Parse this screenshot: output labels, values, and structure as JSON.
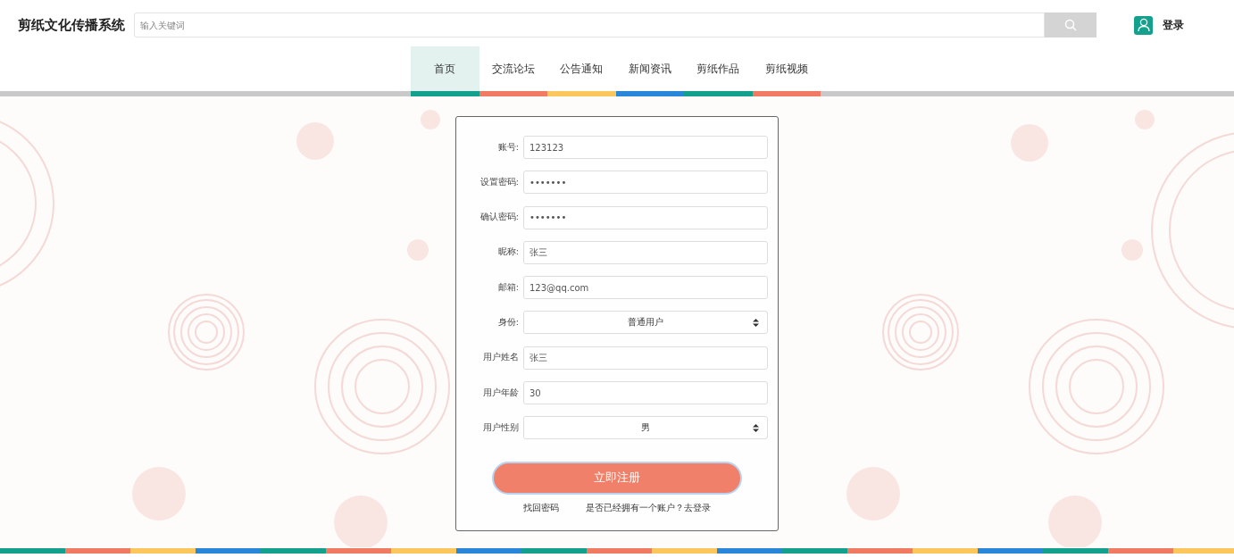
{
  "header": {
    "site_title": "剪纸文化传播系统",
    "search": {
      "placeholder": "输入关键词"
    },
    "login": "登录"
  },
  "nav": [
    {
      "label": "首页",
      "selected": true,
      "color": "#13a08c"
    },
    {
      "label": "交流论坛",
      "selected": false,
      "color": "#f07b62"
    },
    {
      "label": "公告通知",
      "selected": false,
      "color": "#fbc65c"
    },
    {
      "label": "新闻资讯",
      "selected": false,
      "color": "#2a86d9"
    },
    {
      "label": "剪纸作品",
      "selected": false,
      "color": "#13a08c"
    },
    {
      "label": "剪纸视频",
      "selected": false,
      "color": "#f07b62"
    }
  ],
  "form": {
    "fields": [
      {
        "label": "账号:",
        "kind": "input",
        "value": "123123"
      },
      {
        "label": "设置密码:",
        "kind": "input",
        "value": "•••••••"
      },
      {
        "label": "确认密码:",
        "kind": "input",
        "value": "•••••••"
      },
      {
        "label": "昵称:",
        "kind": "input",
        "value": "张三"
      },
      {
        "label": "邮箱:",
        "kind": "input",
        "value": "123@qq.com"
      },
      {
        "label": "身份:",
        "kind": "select",
        "value": "普通用户"
      },
      {
        "label": "用户姓名",
        "kind": "input",
        "value": "张三"
      },
      {
        "label": "用户年龄",
        "kind": "input",
        "value": "30"
      },
      {
        "label": "用户性别",
        "kind": "select",
        "value": "男"
      }
    ],
    "submit": "立即注册",
    "links": [
      "找回密码",
      "是否已经拥有一个账户？去登录"
    ]
  }
}
